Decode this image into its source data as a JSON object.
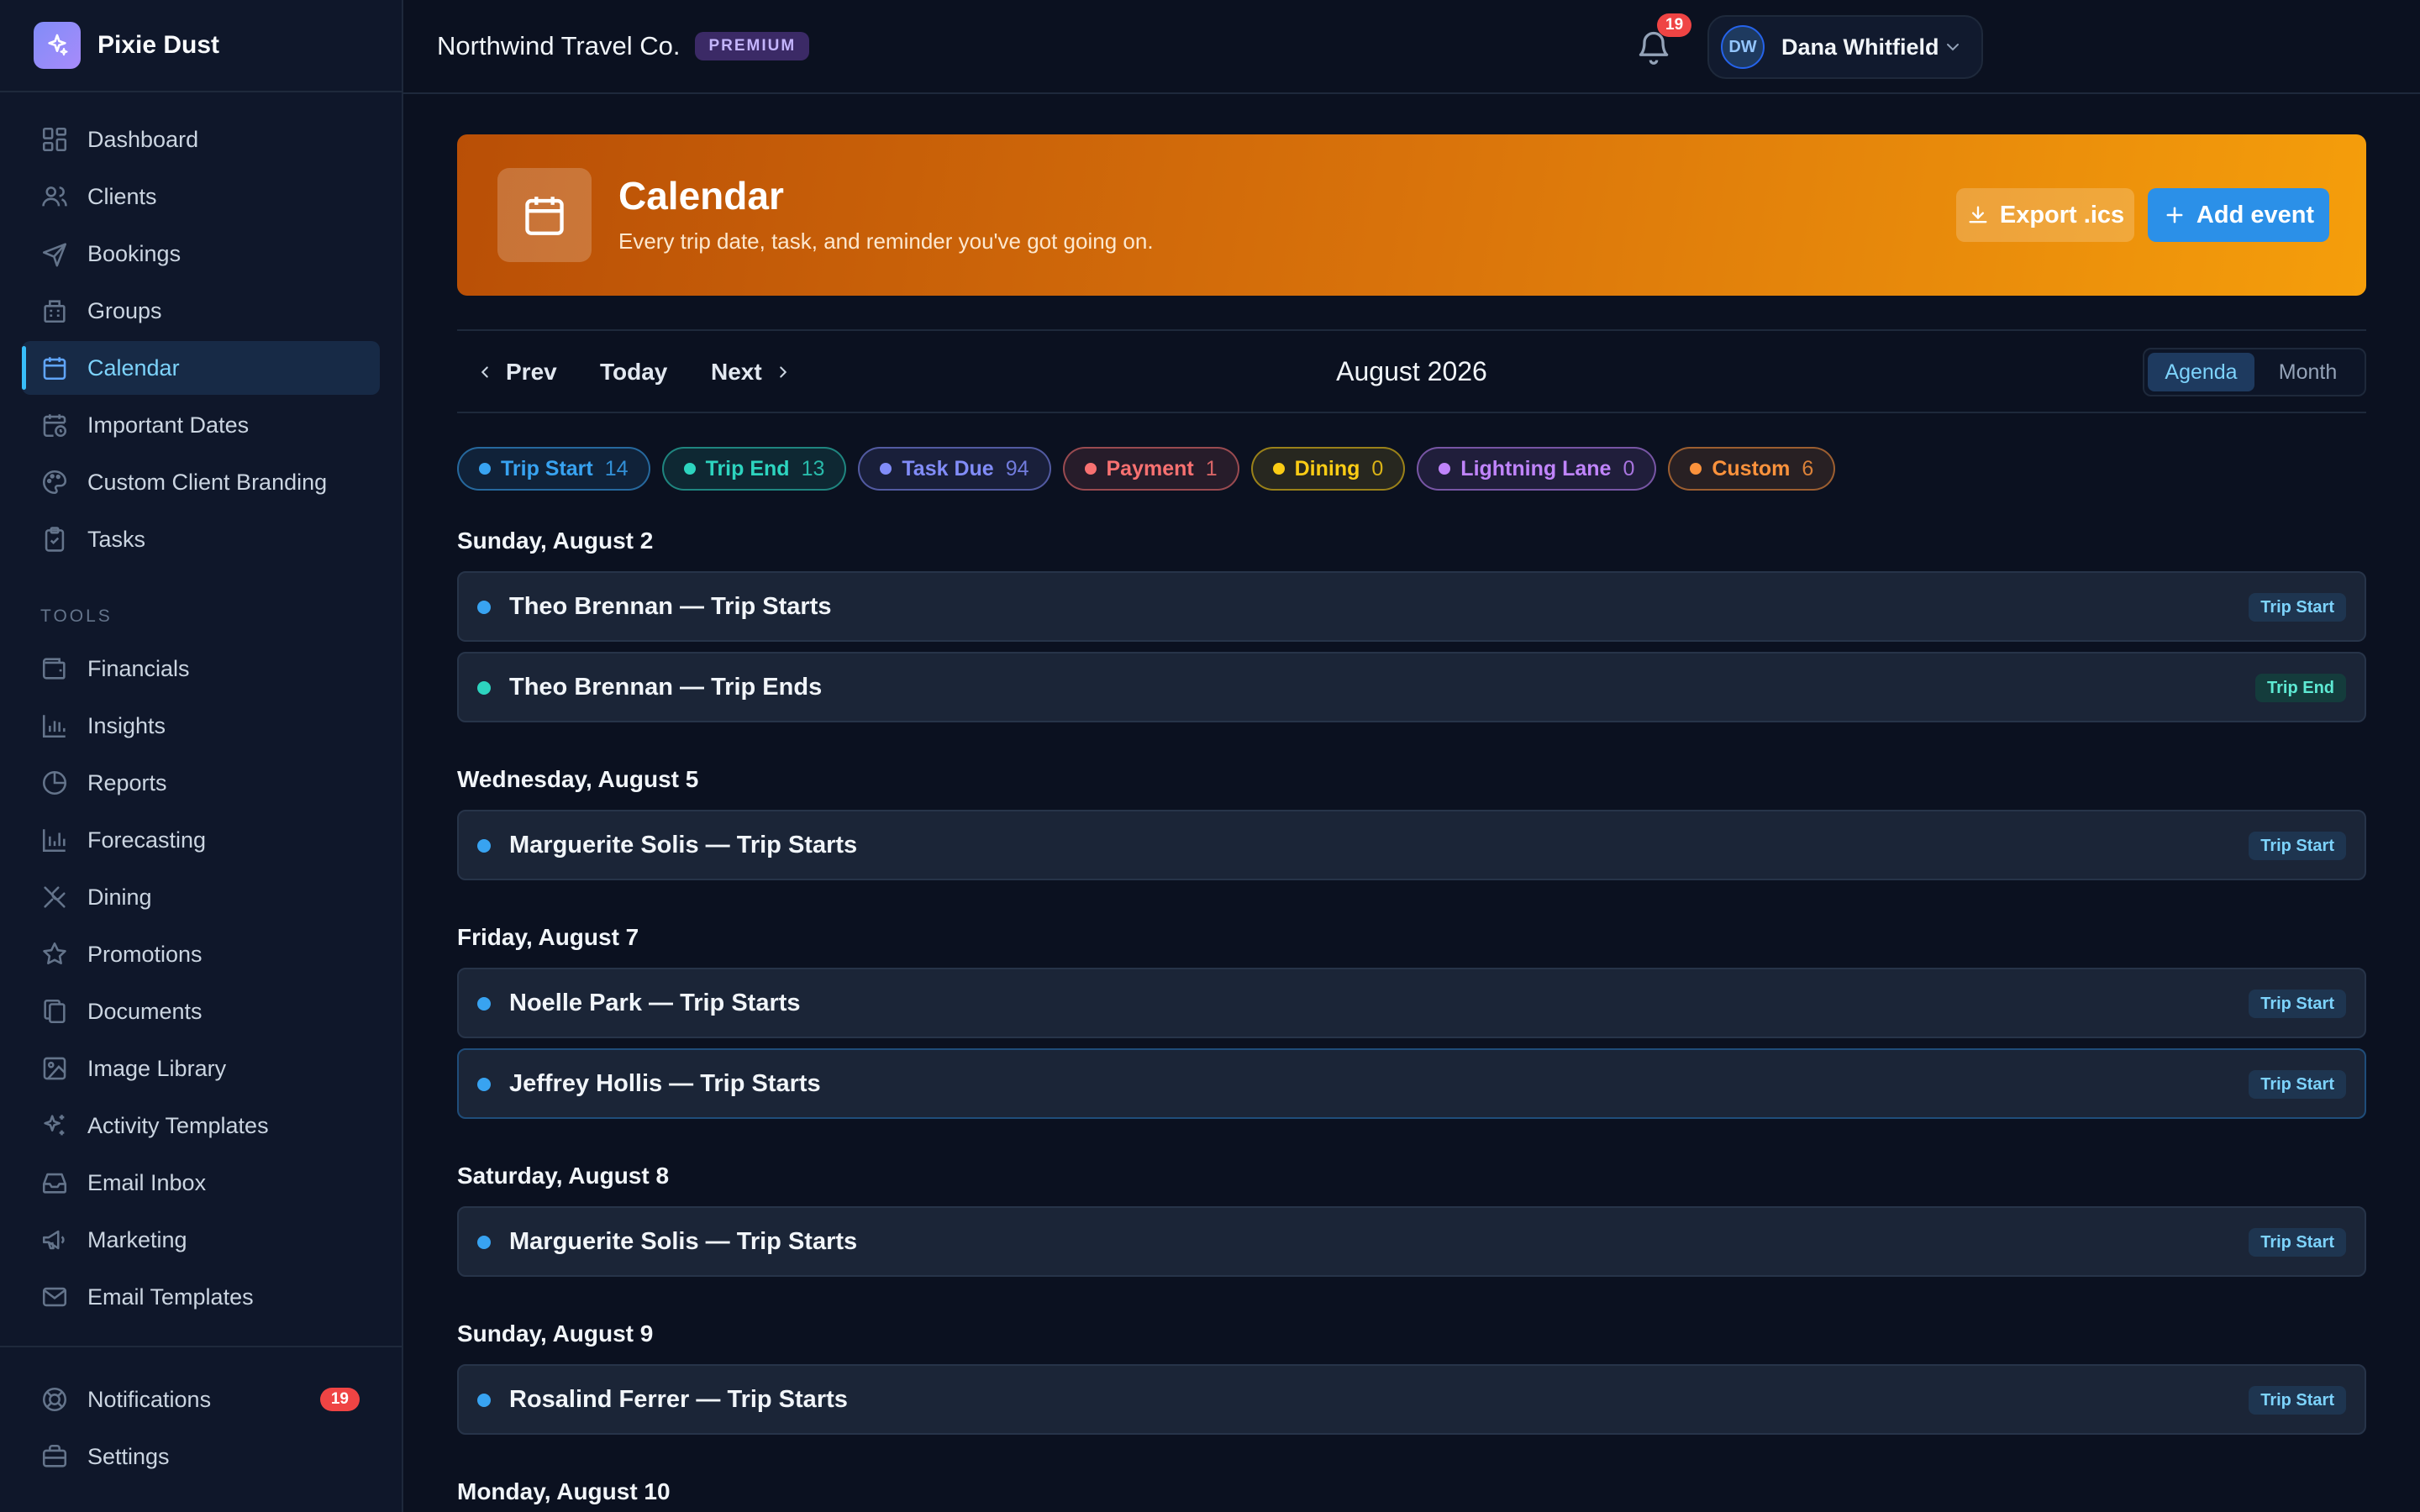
{
  "brand": {
    "name": "Pixie Dust"
  },
  "sidebar": {
    "main_items": [
      {
        "label": "Dashboard",
        "icon": "dashboard-icon"
      },
      {
        "label": "Clients",
        "icon": "users-icon"
      },
      {
        "label": "Bookings",
        "icon": "plane-icon"
      },
      {
        "label": "Groups",
        "icon": "building-icon"
      },
      {
        "label": "Calendar",
        "icon": "calendar-icon",
        "active": true
      },
      {
        "label": "Important Dates",
        "icon": "calendar-clock-icon"
      },
      {
        "label": "Custom Client Branding",
        "icon": "palette-icon"
      },
      {
        "label": "Tasks",
        "icon": "clipboard-icon"
      }
    ],
    "tools_heading": "TOOLS",
    "tools_items": [
      {
        "label": "Financials",
        "icon": "wallet-icon"
      },
      {
        "label": "Insights",
        "icon": "bar-chart-icon"
      },
      {
        "label": "Reports",
        "icon": "pie-chart-icon"
      },
      {
        "label": "Forecasting",
        "icon": "bar-chart-icon"
      },
      {
        "label": "Dining",
        "icon": "utensils-icon"
      },
      {
        "label": "Promotions",
        "icon": "star-icon"
      },
      {
        "label": "Documents",
        "icon": "files-icon"
      },
      {
        "label": "Image Library",
        "icon": "image-icon"
      },
      {
        "label": "Activity Templates",
        "icon": "sparkles-icon"
      },
      {
        "label": "Email Inbox",
        "icon": "inbox-icon"
      },
      {
        "label": "Marketing",
        "icon": "megaphone-icon"
      },
      {
        "label": "Email Templates",
        "icon": "mail-icon"
      }
    ],
    "footer_items": [
      {
        "label": "Notifications",
        "icon": "lifebuoy-icon",
        "badge": "19"
      },
      {
        "label": "Settings",
        "icon": "briefcase-icon"
      }
    ]
  },
  "header": {
    "org_name": "Northwind Travel Co.",
    "plan": "PREMIUM",
    "notification_count": "19",
    "user": {
      "initials": "DW",
      "name": "Dana Whitfield"
    }
  },
  "hero": {
    "title": "Calendar",
    "subtitle": "Every trip date, task, and reminder you've got going on.",
    "export_label": "Export .ics",
    "add_label": "Add event"
  },
  "calendar_nav": {
    "prev": "Prev",
    "today": "Today",
    "next": "Next",
    "month": "August 2026",
    "views": [
      "Agenda",
      "Month"
    ],
    "active_view": "Agenda"
  },
  "filters": [
    {
      "label": "Trip Start",
      "count": "14",
      "color": "#38a3f1"
    },
    {
      "label": "Trip End",
      "count": "13",
      "color": "#2dd4bf"
    },
    {
      "label": "Task Due",
      "count": "94",
      "color": "#818cf8"
    },
    {
      "label": "Payment",
      "count": "1",
      "color": "#f87171"
    },
    {
      "label": "Dining",
      "count": "0",
      "color": "#facc15"
    },
    {
      "label": "Lightning Lane",
      "count": "0",
      "color": "#c084fc"
    },
    {
      "label": "Custom",
      "count": "6",
      "color": "#fb923c"
    }
  ],
  "agenda": [
    {
      "date": "Sunday, August 2",
      "events": [
        {
          "title": "Theo Brennan — Trip Starts",
          "tag": "Trip Start",
          "kind": "start"
        },
        {
          "title": "Theo Brennan — Trip Ends",
          "tag": "Trip End",
          "kind": "end"
        }
      ]
    },
    {
      "date": "Wednesday, August 5",
      "events": [
        {
          "title": "Marguerite Solis — Trip Starts",
          "tag": "Trip Start",
          "kind": "start"
        }
      ]
    },
    {
      "date": "Friday, August 7",
      "events": [
        {
          "title": "Noelle Park — Trip Starts",
          "tag": "Trip Start",
          "kind": "start"
        },
        {
          "title": "Jeffrey Hollis — Trip Starts",
          "tag": "Trip Start",
          "kind": "start",
          "selected": true
        }
      ]
    },
    {
      "date": "Saturday, August 8",
      "events": [
        {
          "title": "Marguerite Solis — Trip Starts",
          "tag": "Trip Start",
          "kind": "start"
        }
      ]
    },
    {
      "date": "Sunday, August 9",
      "events": [
        {
          "title": "Rosalind Ferrer — Trip Starts",
          "tag": "Trip Start",
          "kind": "start"
        }
      ]
    },
    {
      "date": "Monday, August 10",
      "events": []
    }
  ],
  "colors": {
    "trip_start": "#38a3f1",
    "trip_end": "#2dd4bf",
    "accent": "#38bdf8",
    "hero_start": "#b94f06",
    "hero_end": "#f59e0b"
  }
}
